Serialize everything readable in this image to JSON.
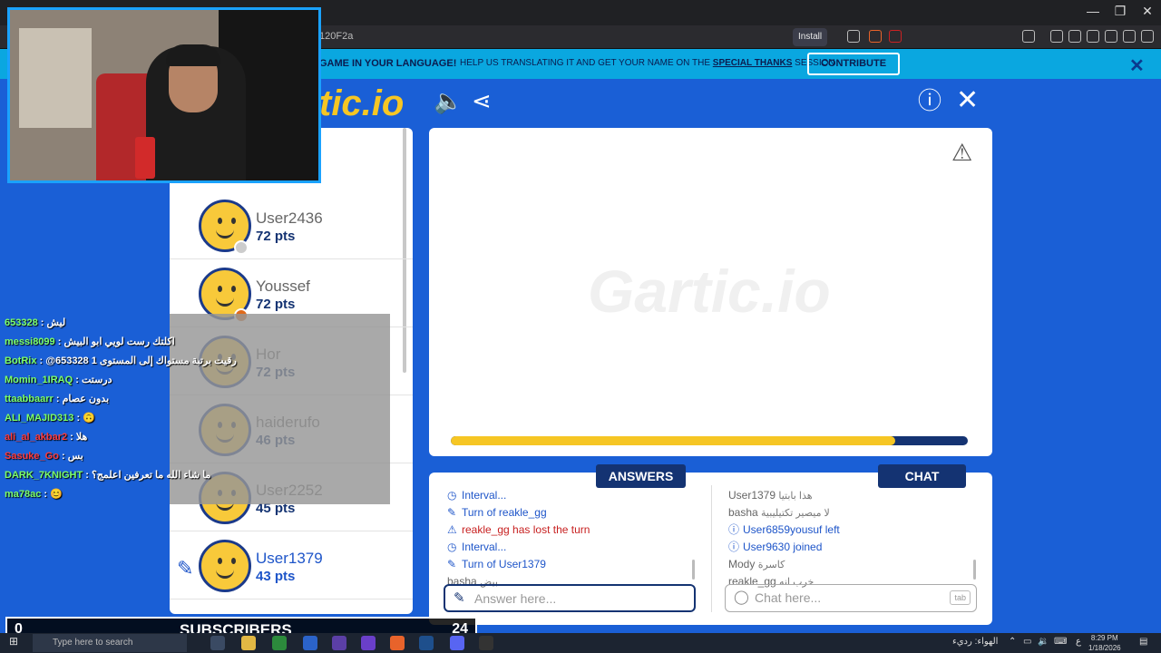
{
  "browser": {
    "url_fragment": "120F2a",
    "install_label": "Install"
  },
  "banner": {
    "bold_text": "GAME IN YOUR LANGUAGE!",
    "text_before": "HELP US TRANSLATING IT AND GET YOUR NAME ON THE",
    "link_text": "SPECIAL THANKS",
    "text_after": "SESSION",
    "contribute_label": "CONTRIBUTE",
    "close_glyph": "✕"
  },
  "header": {
    "logo_text": "tic.io"
  },
  "players": [
    {
      "name": "User2436",
      "points": "72 pts",
      "status": "#cccccc",
      "active": false
    },
    {
      "name": "Youssef",
      "points": "72 pts",
      "status": "#e06a1a",
      "active": false
    },
    {
      "name": "Hor",
      "points": "72 pts",
      "status": "",
      "active": false
    },
    {
      "name": "haiderufo",
      "points": "46 pts",
      "status": "",
      "active": false
    },
    {
      "name": "User2252",
      "points": "45 pts",
      "status": "",
      "active": false
    },
    {
      "name": "User1379",
      "points": "43 pts",
      "status": "",
      "active": true
    }
  ],
  "canvas": {
    "watermark": "Gartic.io",
    "progress": 0.86
  },
  "answers": {
    "label": "ANSWERS",
    "placeholder": "Answer here...",
    "messages": [
      {
        "icon": "clock-icon",
        "glyph": "◷",
        "parts": [
          {
            "t": "Interval...",
            "c": "blue"
          }
        ]
      },
      {
        "icon": "pencil-icon",
        "glyph": "✎",
        "parts": [
          {
            "t": "Turn of ",
            "c": "blue"
          },
          {
            "t": "reakle_gg",
            "c": "blue"
          }
        ]
      },
      {
        "icon": "warning-icon",
        "glyph": "⚠",
        "parts": [
          {
            "t": "reakle_gg",
            "c": "red"
          },
          {
            "t": " has lost the turn",
            "c": "red"
          }
        ]
      },
      {
        "icon": "clock-icon",
        "glyph": "◷",
        "parts": [
          {
            "t": "Interval...",
            "c": "blue"
          }
        ]
      },
      {
        "icon": "pencil-icon",
        "glyph": "✎",
        "parts": [
          {
            "t": "Turn of ",
            "c": "blue"
          },
          {
            "t": "User1379",
            "c": "blue"
          }
        ]
      },
      {
        "icon": "",
        "glyph": "",
        "parts": [
          {
            "t": "basha ",
            "c": "gray"
          },
          {
            "t": "بيض",
            "c": "small-ar"
          }
        ]
      }
    ]
  },
  "chat": {
    "label": "CHAT",
    "placeholder": "Chat here...",
    "tab_hint": "tab",
    "messages": [
      {
        "icon": "",
        "glyph": "",
        "parts": [
          {
            "t": "User1379 ",
            "c": "gray"
          },
          {
            "t": "هذا بابتيا",
            "c": "small-ar"
          }
        ]
      },
      {
        "icon": "",
        "glyph": "",
        "parts": [
          {
            "t": "basha ",
            "c": "gray"
          },
          {
            "t": "لا ميصير تكتيليبية",
            "c": "small-ar"
          }
        ]
      },
      {
        "icon": "info-icon",
        "glyph": "ⓘ",
        "parts": [
          {
            "t": "User6859yousuf",
            "c": "blue"
          },
          {
            "t": " left",
            "c": "blue"
          }
        ]
      },
      {
        "icon": "info-icon",
        "glyph": "ⓘ",
        "parts": [
          {
            "t": "User9630",
            "c": "blue"
          },
          {
            "t": " joined",
            "c": "blue"
          }
        ]
      },
      {
        "icon": "",
        "glyph": "",
        "parts": [
          {
            "t": "Mody ",
            "c": "gray"
          },
          {
            "t": "كاسرة",
            "c": "small-ar"
          }
        ]
      },
      {
        "icon": "",
        "glyph": "",
        "parts": [
          {
            "t": "reakle_gg ",
            "c": "gray"
          },
          {
            "t": "خرب انه",
            "c": "small-ar"
          }
        ]
      }
    ]
  },
  "stream_chat": [
    {
      "user": "653328",
      "sep": " : ",
      "text": "ليش",
      "ucls": "u"
    },
    {
      "user": "messi8099",
      "sep": " : ",
      "text": "اكلتك رست لويي ابو البيش",
      "ucls": "u"
    },
    {
      "user": "BotRix",
      "sep": " : ",
      "text": "@653328 رقيت برتبة مستواك إلى المستوى 1",
      "ucls": "u"
    },
    {
      "user": "Momin_1IRAQ",
      "sep": " : ",
      "text": "درستت",
      "ucls": "u"
    },
    {
      "user": "ttaabbaarr",
      "sep": " : ",
      "text": "بدون عصام",
      "ucls": "u"
    },
    {
      "user": "ALI_MAJID313",
      "sep": " : ",
      "text": "🙃",
      "ucls": "u"
    },
    {
      "user": "ali_al_akbar2",
      "sep": " : ",
      "text": "هلا",
      "ucls": "u-red"
    },
    {
      "user": "Sasuke_Go",
      "sep": " : ",
      "text": "بس",
      "ucls": "u-red"
    },
    {
      "user": "DARK_7KNIGHT",
      "sep": " : ",
      "text": "ما شاء الله ما تعرفين اعلمج؟",
      "ucls": "u"
    },
    {
      "user": "ma78ac",
      "sep": " : ",
      "text": "😊",
      "ucls": "u"
    }
  ],
  "subscribers": {
    "left_count": "0",
    "title": "SUBSCRIBERS",
    "right_count": "24"
  },
  "taskbar": {
    "search_placeholder": "Type here to search",
    "weather": "الهواء: رديء",
    "lang": "ع",
    "time": "8:29 PM",
    "date": "1/18/2026"
  }
}
